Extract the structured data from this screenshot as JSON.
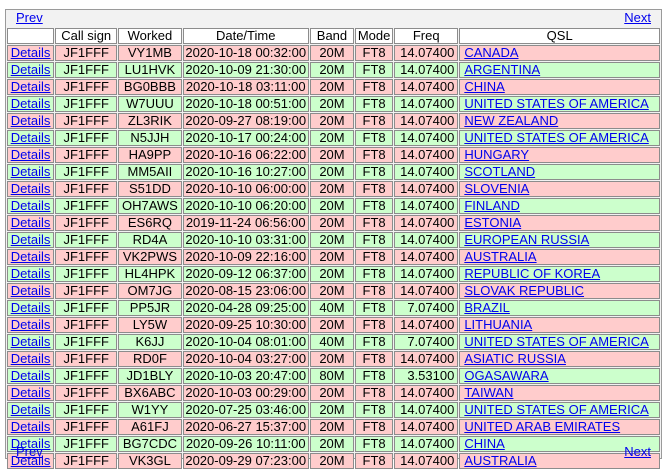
{
  "nav": {
    "prev": "Prev",
    "next": "Next"
  },
  "colors": {
    "row_odd": "#ffcccc",
    "row_even": "#ccffcc",
    "link": "#0000ee"
  },
  "table": {
    "headers": [
      "",
      "Call sign",
      "Worked",
      "Date/Time",
      "Band",
      "Mode",
      "Freq",
      "QSL"
    ],
    "details_label": "Details",
    "rows": [
      {
        "call": "JF1FFF",
        "worked": "VY1MB",
        "datetime": "2020-10-18 00:32:00",
        "band": "20M",
        "mode": "FT8",
        "freq": "14.07400",
        "qsl": "CANADA"
      },
      {
        "call": "JF1FFF",
        "worked": "LU1HVK",
        "datetime": "2020-10-09 21:30:00",
        "band": "20M",
        "mode": "FT8",
        "freq": "14.07400",
        "qsl": "ARGENTINA"
      },
      {
        "call": "JF1FFF",
        "worked": "BG0BBB",
        "datetime": "2020-10-18 03:11:00",
        "band": "20M",
        "mode": "FT8",
        "freq": "14.07400",
        "qsl": "CHINA"
      },
      {
        "call": "JF1FFF",
        "worked": "W7UUU",
        "datetime": "2020-10-18 00:51:00",
        "band": "20M",
        "mode": "FT8",
        "freq": "14.07400",
        "qsl": "UNITED STATES OF AMERICA"
      },
      {
        "call": "JF1FFF",
        "worked": "ZL3RIK",
        "datetime": "2020-09-27 08:19:00",
        "band": "20M",
        "mode": "FT8",
        "freq": "14.07400",
        "qsl": "NEW ZEALAND"
      },
      {
        "call": "JF1FFF",
        "worked": "N5JJH",
        "datetime": "2020-10-17 00:24:00",
        "band": "20M",
        "mode": "FT8",
        "freq": "14.07400",
        "qsl": "UNITED STATES OF AMERICA"
      },
      {
        "call": "JF1FFF",
        "worked": "HA9PP",
        "datetime": "2020-10-16 06:22:00",
        "band": "20M",
        "mode": "FT8",
        "freq": "14.07400",
        "qsl": "HUNGARY"
      },
      {
        "call": "JF1FFF",
        "worked": "MM5AII",
        "datetime": "2020-10-16 10:27:00",
        "band": "20M",
        "mode": "FT8",
        "freq": "14.07400",
        "qsl": "SCOTLAND"
      },
      {
        "call": "JF1FFF",
        "worked": "S51DD",
        "datetime": "2020-10-10 06:00:00",
        "band": "20M",
        "mode": "FT8",
        "freq": "14.07400",
        "qsl": "SLOVENIA"
      },
      {
        "call": "JF1FFF",
        "worked": "OH7AWS",
        "datetime": "2020-10-10 06:20:00",
        "band": "20M",
        "mode": "FT8",
        "freq": "14.07400",
        "qsl": "FINLAND"
      },
      {
        "call": "JF1FFF",
        "worked": "ES6RQ",
        "datetime": "2019-11-24 06:56:00",
        "band": "20M",
        "mode": "FT8",
        "freq": "14.07400",
        "qsl": "ESTONIA"
      },
      {
        "call": "JF1FFF",
        "worked": "RD4A",
        "datetime": "2020-10-10 03:31:00",
        "band": "20M",
        "mode": "FT8",
        "freq": "14.07400",
        "qsl": "EUROPEAN RUSSIA"
      },
      {
        "call": "JF1FFF",
        "worked": "VK2PWS",
        "datetime": "2020-10-09 22:16:00",
        "band": "20M",
        "mode": "FT8",
        "freq": "14.07400",
        "qsl": "AUSTRALIA"
      },
      {
        "call": "JF1FFF",
        "worked": "HL4HPK",
        "datetime": "2020-09-12 06:37:00",
        "band": "20M",
        "mode": "FT8",
        "freq": "14.07400",
        "qsl": "REPUBLIC OF KOREA"
      },
      {
        "call": "JF1FFF",
        "worked": "OM7JG",
        "datetime": "2020-08-15 23:06:00",
        "band": "20M",
        "mode": "FT8",
        "freq": "14.07400",
        "qsl": "SLOVAK REPUBLIC"
      },
      {
        "call": "JF1FFF",
        "worked": "PP5JR",
        "datetime": "2020-04-28 09:25:00",
        "band": "40M",
        "mode": "FT8",
        "freq": "7.07400",
        "qsl": "BRAZIL"
      },
      {
        "call": "JF1FFF",
        "worked": "LY5W",
        "datetime": "2020-09-25 10:30:00",
        "band": "20M",
        "mode": "FT8",
        "freq": "14.07400",
        "qsl": "LITHUANIA"
      },
      {
        "call": "JF1FFF",
        "worked": "K6JJ",
        "datetime": "2020-10-04 08:01:00",
        "band": "40M",
        "mode": "FT8",
        "freq": "7.07400",
        "qsl": "UNITED STATES OF AMERICA"
      },
      {
        "call": "JF1FFF",
        "worked": "RD0F",
        "datetime": "2020-10-04 03:27:00",
        "band": "20M",
        "mode": "FT8",
        "freq": "14.07400",
        "qsl": "ASIATIC RUSSIA"
      },
      {
        "call": "JF1FFF",
        "worked": "JD1BLY",
        "datetime": "2020-10-03 20:47:00",
        "band": "80M",
        "mode": "FT8",
        "freq": "3.53100",
        "qsl": "OGASAWARA"
      },
      {
        "call": "JF1FFF",
        "worked": "BX6ABC",
        "datetime": "2020-10-03 00:29:00",
        "band": "20M",
        "mode": "FT8",
        "freq": "14.07400",
        "qsl": "TAIWAN"
      },
      {
        "call": "JF1FFF",
        "worked": "W1YY",
        "datetime": "2020-07-25 03:46:00",
        "band": "20M",
        "mode": "FT8",
        "freq": "14.07400",
        "qsl": "UNITED STATES OF AMERICA"
      },
      {
        "call": "JF1FFF",
        "worked": "A61FJ",
        "datetime": "2020-06-27 15:37:00",
        "band": "20M",
        "mode": "FT8",
        "freq": "14.07400",
        "qsl": "UNITED ARAB EMIRATES"
      },
      {
        "call": "JF1FFF",
        "worked": "BG7CDC",
        "datetime": "2020-09-26 10:11:00",
        "band": "20M",
        "mode": "FT8",
        "freq": "14.07400",
        "qsl": "CHINA"
      },
      {
        "call": "JF1FFF",
        "worked": "VK3GL",
        "datetime": "2020-09-29 07:23:00",
        "band": "20M",
        "mode": "FT8",
        "freq": "14.07400",
        "qsl": "AUSTRALIA"
      }
    ]
  }
}
